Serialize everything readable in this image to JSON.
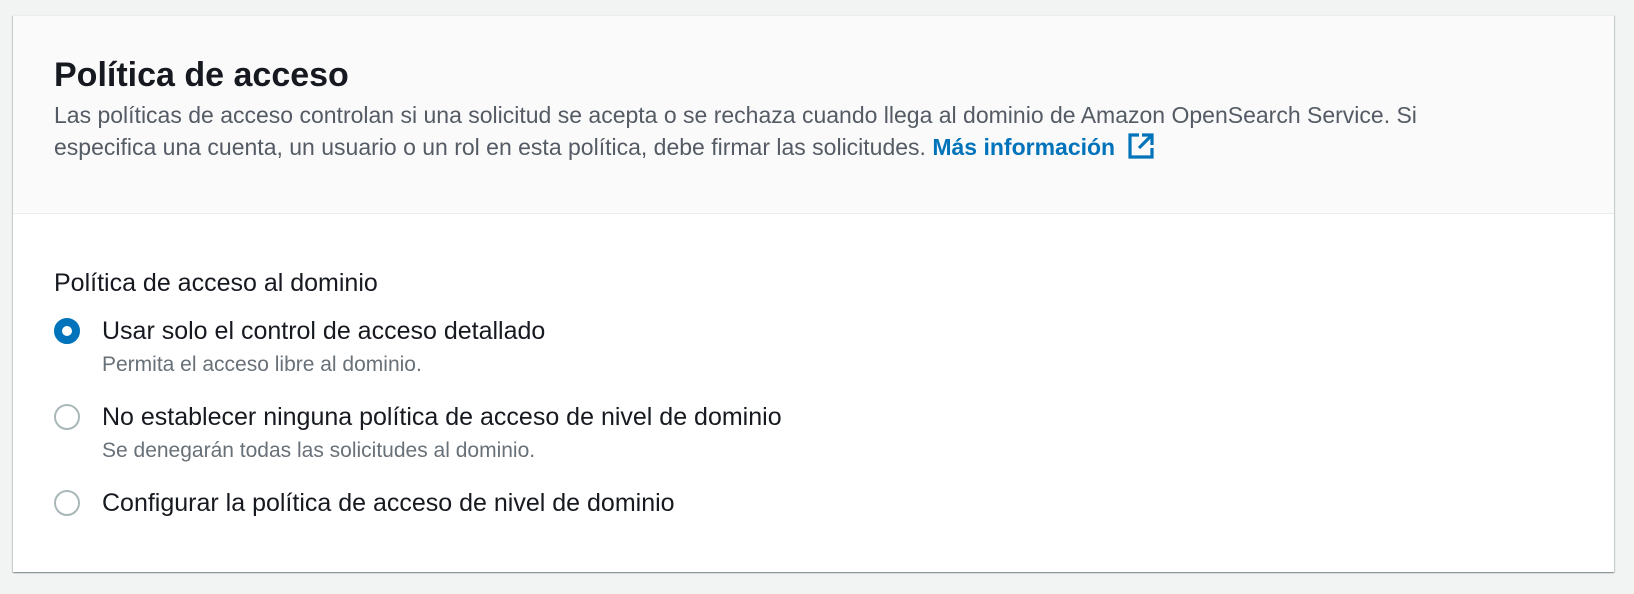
{
  "header": {
    "title": "Política de acceso",
    "description": "Las políticas de acceso controlan si una solicitud se acepta o se rechaza cuando llega al dominio de Amazon OpenSearch Service. Si especifica una cuenta, un usuario o un rol en esta política, debe firmar las solicitudes.",
    "link_label": "Más información",
    "link_icon": "external-link-icon"
  },
  "domain_policy": {
    "label": "Política de acceso al dominio",
    "selected_index": 0,
    "options": [
      {
        "label": "Usar solo el control de acceso detallado",
        "description": "Permita el acceso libre al dominio."
      },
      {
        "label": "No establecer ninguna política de acceso de nivel de dominio",
        "description": "Se denegarán todas las solicitudes al dominio."
      },
      {
        "label": "Configurar la política de acceso de nivel de dominio",
        "description": ""
      }
    ]
  },
  "colors": {
    "accent": "#0073bb",
    "text": "#16191f",
    "muted": "#545b64",
    "radio_border": "#aab7b8"
  }
}
